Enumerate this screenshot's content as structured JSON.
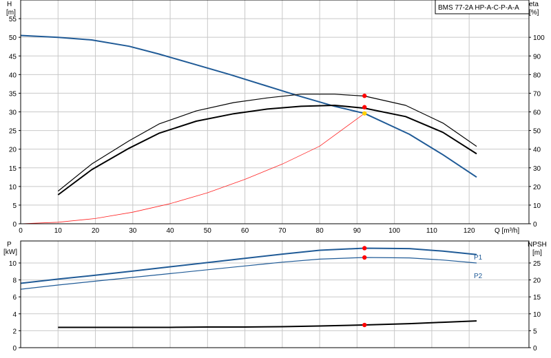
{
  "chart_data": [
    {
      "type": "line",
      "panel": "top",
      "pump_title": "BMS 77-2A HP-A-C-P-A-A",
      "y_left_label": "H",
      "y_left_unit": "[m]",
      "y_right_label": "eta",
      "y_right_unit": "[%]",
      "x_label": "Q [m³/h]",
      "x_ticks": [
        "0",
        "10",
        "20",
        "30",
        "40",
        "50",
        "60",
        "70",
        "80",
        "90",
        "100",
        "110",
        "120"
      ],
      "y_left_ticks": [
        "0",
        "5",
        "10",
        "15",
        "20",
        "25",
        "30",
        "35",
        "40",
        "45",
        "50",
        "55"
      ],
      "y_right_ticks": [
        "0",
        "10",
        "20",
        "30",
        "40",
        "50",
        "60",
        "70",
        "80",
        "90",
        "100"
      ],
      "xlim": [
        0,
        136
      ],
      "ylim_left": [
        0,
        60
      ],
      "ylim_right": [
        0,
        120
      ],
      "grid": true,
      "series": [
        {
          "key": "H",
          "axis": "left",
          "color": "#1f5a96",
          "x": [
            0,
            10,
            19,
            29,
            37,
            46,
            56,
            65,
            74,
            84,
            92,
            104,
            113,
            122
          ],
          "y": [
            50.5,
            50,
            49.3,
            47.6,
            45.5,
            42.9,
            40,
            37.2,
            34.4,
            31.5,
            29.6,
            24,
            18.5,
            12.5
          ]
        },
        {
          "key": "eta_upper",
          "axis": "right",
          "color": "#000000",
          "x": [
            10,
            19,
            29,
            37,
            47,
            57,
            66,
            75,
            84,
            92,
            103,
            113,
            122
          ],
          "y": [
            17.5,
            32,
            44.5,
            53.5,
            60.5,
            65,
            67.5,
            69.5,
            69.5,
            68.5,
            63.5,
            54,
            41.5
          ]
        },
        {
          "key": "eta_lower",
          "axis": "right",
          "color": "#000000",
          "x": [
            10,
            19,
            29,
            37,
            47,
            57,
            66,
            75,
            84,
            92,
            103,
            113,
            122
          ],
          "y": [
            15.5,
            29,
            40.5,
            48.5,
            55,
            59,
            61.5,
            63,
            63.5,
            62,
            57.5,
            49,
            37.5
          ]
        },
        {
          "key": "system_curve",
          "axis": "left",
          "color": "#ff2020",
          "x": [
            0,
            10,
            20,
            30,
            40,
            50,
            60,
            70,
            80,
            92
          ],
          "y": [
            0,
            0.4,
            1.4,
            3.1,
            5.4,
            8.3,
            11.9,
            16,
            20.8,
            29.6
          ]
        }
      ],
      "operating_points": [
        {
          "axis": "right",
          "x": 92,
          "y": 68.6,
          "color": "#ff0000"
        },
        {
          "axis": "right",
          "x": 92,
          "y": 62.5,
          "color": "#ff0000"
        },
        {
          "axis": "left",
          "x": 92,
          "y": 29.6,
          "color": "#ffd000"
        }
      ]
    },
    {
      "type": "line",
      "panel": "bottom",
      "y_left_label": "P",
      "y_left_unit": "[kW]",
      "y_right_label": "NPSH",
      "y_right_unit": "[m]",
      "y_left_ticks": [
        "0",
        "2",
        "4",
        "6",
        "8",
        "10"
      ],
      "y_right_ticks": [
        "0",
        "5",
        "10",
        "15",
        "20",
        "25"
      ],
      "xlim": [
        0,
        136
      ],
      "ylim_left": [
        0,
        12.6
      ],
      "ylim_right": [
        0,
        31.5
      ],
      "grid": true,
      "series": [
        {
          "key": "P1",
          "name": "P1",
          "axis": "left",
          "color": "#1f5a96",
          "x": [
            0,
            10,
            20,
            30,
            40,
            50,
            60,
            70,
            80,
            92,
            104,
            113,
            122
          ],
          "y": [
            7.6,
            8.1,
            8.55,
            9.05,
            9.55,
            10.05,
            10.55,
            11.05,
            11.5,
            11.75,
            11.7,
            11.4,
            11
          ]
        },
        {
          "key": "P2",
          "name": "P2",
          "axis": "left",
          "color": "#1f5a96",
          "x": [
            0,
            10,
            20,
            30,
            40,
            50,
            60,
            70,
            80,
            92,
            104,
            113,
            122
          ],
          "y": [
            6.9,
            7.4,
            7.85,
            8.3,
            8.75,
            9.2,
            9.65,
            10.1,
            10.45,
            10.65,
            10.6,
            10.35,
            10
          ]
        },
        {
          "key": "NPSH",
          "axis": "right",
          "color": "#000000",
          "x": [
            10,
            20,
            30,
            40,
            50,
            60,
            70,
            80,
            92,
            104,
            113,
            122
          ],
          "y": [
            6,
            6,
            6,
            6,
            6.1,
            6.1,
            6.2,
            6.4,
            6.7,
            7.1,
            7.5,
            7.9
          ]
        }
      ],
      "operating_points": [
        {
          "axis": "left",
          "x": 92,
          "y": 11.75,
          "color": "#ff0000"
        },
        {
          "axis": "left",
          "x": 92,
          "y": 10.65,
          "color": "#ff0000"
        },
        {
          "axis": "right",
          "x": 92,
          "y": 6.7,
          "color": "#ff0000"
        }
      ]
    }
  ]
}
